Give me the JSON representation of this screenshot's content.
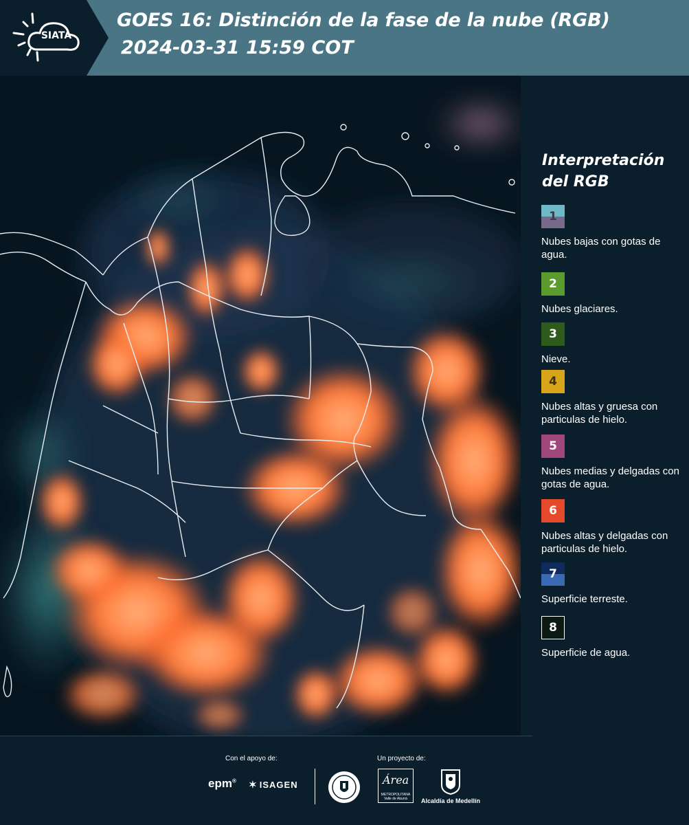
{
  "header": {
    "logo_text": "SIATA",
    "title_line1": "GOES 16: Distinción de la fase de la nube (RGB)",
    "title_line2": "2024-03-31 15:59 COT"
  },
  "legend": {
    "title": "Interpretación del RGB",
    "items": [
      {
        "num": "1",
        "label": "Nubes bajas con gotas de agua.",
        "color_top": "#6fb8c5",
        "color_bottom": "#776a8a"
      },
      {
        "num": "2",
        "label": "Nubes glaciares.",
        "color_top": "#5b9a2c"
      },
      {
        "num": "3",
        "label": "Nieve.",
        "color_top": "#2e5a1c"
      },
      {
        "num": "4",
        "label": "Nubes altas y gruesa con particulas de hielo.",
        "color_top": "#d8a419"
      },
      {
        "num": "5",
        "label": "Nubes medias y delgadas con gotas de agua.",
        "color_top": "#a0487c"
      },
      {
        "num": "6",
        "label": "Nubes altas y delgadas con particulas de hielo.",
        "color_top": "#e5492b"
      },
      {
        "num": "7",
        "label": "Superficie terreste.",
        "color_top": "#0f2a5c",
        "color_bottom": "#3a6ab4"
      },
      {
        "num": "8",
        "label": "Superficie de agua.",
        "color_top": "#0a1a12"
      }
    ]
  },
  "footer": {
    "support_label": "Con el apoyo de:",
    "project_label": "Un proyecto de:",
    "epm": "epm",
    "epm_mark": "®",
    "isagen": "ISAGEN",
    "area_script": "Área",
    "area_caption": "METROPOLITANA Valle de Aburrá",
    "alcaldia": "Alcaldía de Medellín"
  }
}
